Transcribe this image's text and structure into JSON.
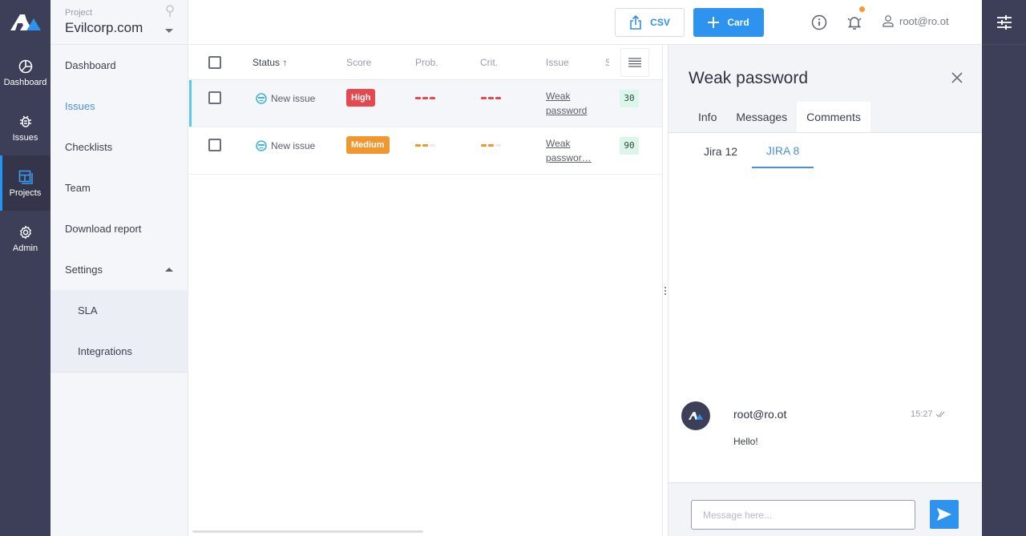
{
  "rail": {
    "items": [
      {
        "label": "Dashboard",
        "icon": "dashboard-icon"
      },
      {
        "label": "Issues",
        "icon": "bug-icon"
      },
      {
        "label": "Projects",
        "icon": "projects-icon",
        "active": true
      },
      {
        "label": "Admin",
        "icon": "gear-icon"
      }
    ]
  },
  "project": {
    "label": "Project",
    "name": "Evilcorp.com"
  },
  "nav": {
    "items": [
      {
        "label": "Dashboard"
      },
      {
        "label": "Issues",
        "active": true
      },
      {
        "label": "Checklists"
      },
      {
        "label": "Team"
      },
      {
        "label": "Download report"
      },
      {
        "label": "Settings",
        "expanded": true
      }
    ],
    "settings_sub": [
      {
        "label": "SLA"
      },
      {
        "label": "Integrations"
      }
    ]
  },
  "toolbar": {
    "csv_label": "CSV",
    "card_label": "Card",
    "user": "root@ro.ot"
  },
  "table": {
    "columns": [
      "Status",
      "Score",
      "Prob.",
      "Crit.",
      "Issue",
      "S"
    ],
    "sort_indicator": "↑",
    "rows": [
      {
        "status": "New issue",
        "score": "High",
        "score_color": "#e5484d",
        "prob_level": 3,
        "crit_level": 3,
        "level_color": "#e5484d",
        "issue_line1": "Weak",
        "issue_line2": "password",
        "number": "30",
        "selected": true
      },
      {
        "status": "New issue",
        "score": "Medium",
        "score_color": "#f0982f",
        "prob_level": 2,
        "crit_level": 2,
        "level_color": "#f0982f",
        "issue_line1": "Weak",
        "issue_line2": "passwor…",
        "number": "90",
        "selected": false
      }
    ]
  },
  "panel": {
    "title": "Weak password",
    "tabs": [
      {
        "label": "Info"
      },
      {
        "label": "Messages"
      },
      {
        "label": "Comments",
        "active": true
      }
    ],
    "subtabs": [
      {
        "label": "Jira 12"
      },
      {
        "label": "JIRA 8",
        "active": true
      }
    ],
    "comment": {
      "author": "root@ro.ot",
      "time": "15:27",
      "text": "Hello!"
    },
    "composer": {
      "placeholder": "Message here..."
    }
  },
  "colors": {
    "accent": "#2d93ef",
    "rail_bg": "#3d3f58",
    "notification_dot": "#f39b30",
    "active_link": "#4a90d9"
  }
}
